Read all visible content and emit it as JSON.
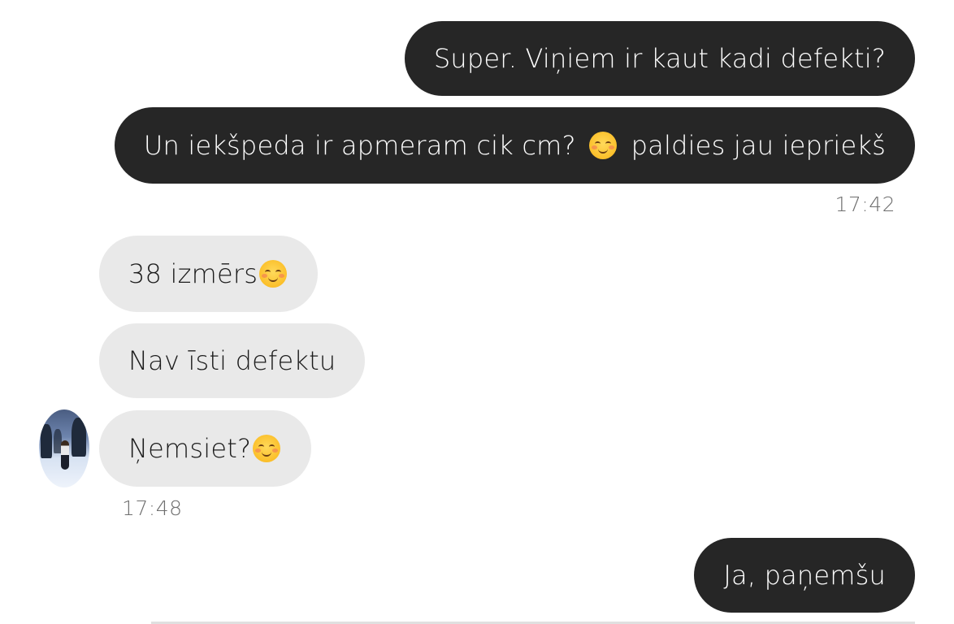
{
  "messages": [
    {
      "id": "m1",
      "direction": "outgoing",
      "text": "Super. Viņiem ir kaut kadi defekti?"
    },
    {
      "id": "m2",
      "direction": "outgoing",
      "text_before": "Un iekšpeda ir apmeram cik cm?",
      "emoji": "smiling-face-emoji",
      "text_after": "paldies jau iepriekš"
    },
    {
      "id": "m3",
      "direction": "incoming",
      "text": "38 izmērs",
      "emoji": "smiling-face-emoji"
    },
    {
      "id": "m4",
      "direction": "incoming",
      "text": "Nav īsti defektu"
    },
    {
      "id": "m5",
      "direction": "incoming",
      "text": "Ņemsiet?",
      "emoji": "smiling-face-emoji"
    },
    {
      "id": "m6",
      "direction": "outgoing",
      "text": "Ja, paņemšu"
    }
  ],
  "timestamps": {
    "outgoing_group": "17:42",
    "incoming_group": "17:48"
  },
  "colors": {
    "outgoing_bubble": "#262626",
    "incoming_bubble": "#e9e9e9",
    "timestamp": "#6e6e6e"
  },
  "avatar": {
    "icon": "contact-avatar"
  }
}
